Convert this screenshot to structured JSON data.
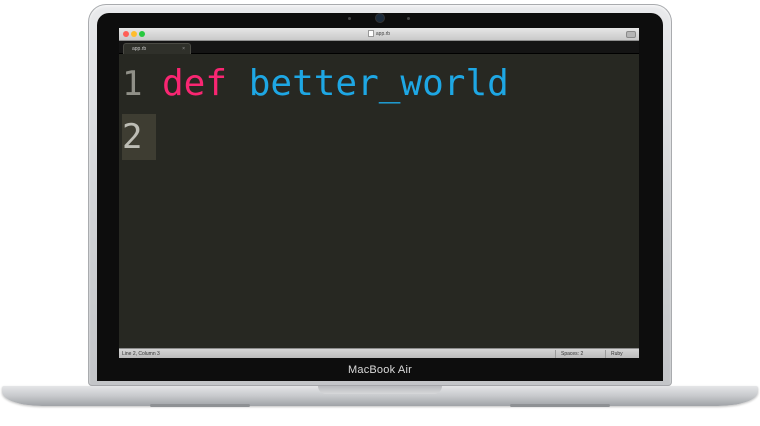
{
  "device": {
    "brand_label": "MacBook Air"
  },
  "window": {
    "title": "app.rb",
    "traffic_lights": {
      "close_color": "#ff5f56",
      "minimize_color": "#ffbd2e",
      "zoom_color": "#27c93f"
    }
  },
  "tabs": [
    {
      "label": "app.rb",
      "close": "×",
      "active": true
    }
  ],
  "editor": {
    "theme": {
      "background": "#272822",
      "keyword_color": "#f92672",
      "function_color": "#1ea7e4"
    },
    "lines": [
      {
        "number": "1",
        "keyword": "def",
        "name": "better_world"
      },
      {
        "number": "2",
        "keyword": "",
        "name": ""
      }
    ],
    "active_line": "2"
  },
  "status_bar": {
    "position": "Line 2, Column 3",
    "indentation": "Spaces: 2",
    "syntax": "Ruby"
  }
}
